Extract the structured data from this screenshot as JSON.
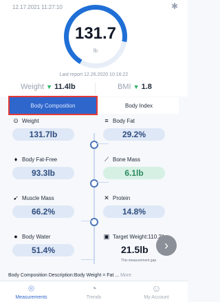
{
  "status": {
    "timestamp": "12.17.2021 11:27:10",
    "bluetooth_icon": "bluetooth-icon"
  },
  "gauge": {
    "value": "131.7",
    "unit": "lb"
  },
  "last_report": "Last report 12.26.2020 10:16:22",
  "summary": {
    "weight_label": "Weight",
    "weight_delta": "11.4lb",
    "bmi_label": "BMI",
    "bmi_delta": "1.8"
  },
  "tabs": {
    "composition": "Body Composition",
    "index": "Body Index"
  },
  "metrics": {
    "weight": {
      "label": "Weight",
      "value": "131.7lb",
      "icon": "scale-icon"
    },
    "body_fat": {
      "label": "Body Fat",
      "value": "29.2%",
      "icon": "fat-icon"
    },
    "body_fat_free": {
      "label": "Body Fat-Free",
      "value": "93.3lb",
      "icon": "lean-mass-icon"
    },
    "bone_mass": {
      "label": "Bone Mass",
      "value": "6.1lb",
      "icon": "bone-icon"
    },
    "muscle_mass": {
      "label": "Muscle Mass",
      "value": "66.2%",
      "icon": "muscle-icon"
    },
    "protein": {
      "label": "Protein",
      "value": "14.8%",
      "icon": "protein-icon"
    },
    "body_water": {
      "label": "Body Water",
      "value": "51.4%",
      "icon": "water-drop-icon"
    },
    "target_weight": {
      "label": "Target Weight:110.2lb",
      "value": "21.5lb",
      "sub": "This measurement gap",
      "icon": "target-icon"
    }
  },
  "description": {
    "text": "Body Composition Description:Body Weight = Fat ...",
    "more": "More"
  },
  "bottom_nav": {
    "measurements": "Measurements",
    "trends": "Trends",
    "account": "My Account"
  },
  "colors": {
    "accent": "#2f66cc",
    "good": "#26b463",
    "highlight": "#e53935"
  }
}
